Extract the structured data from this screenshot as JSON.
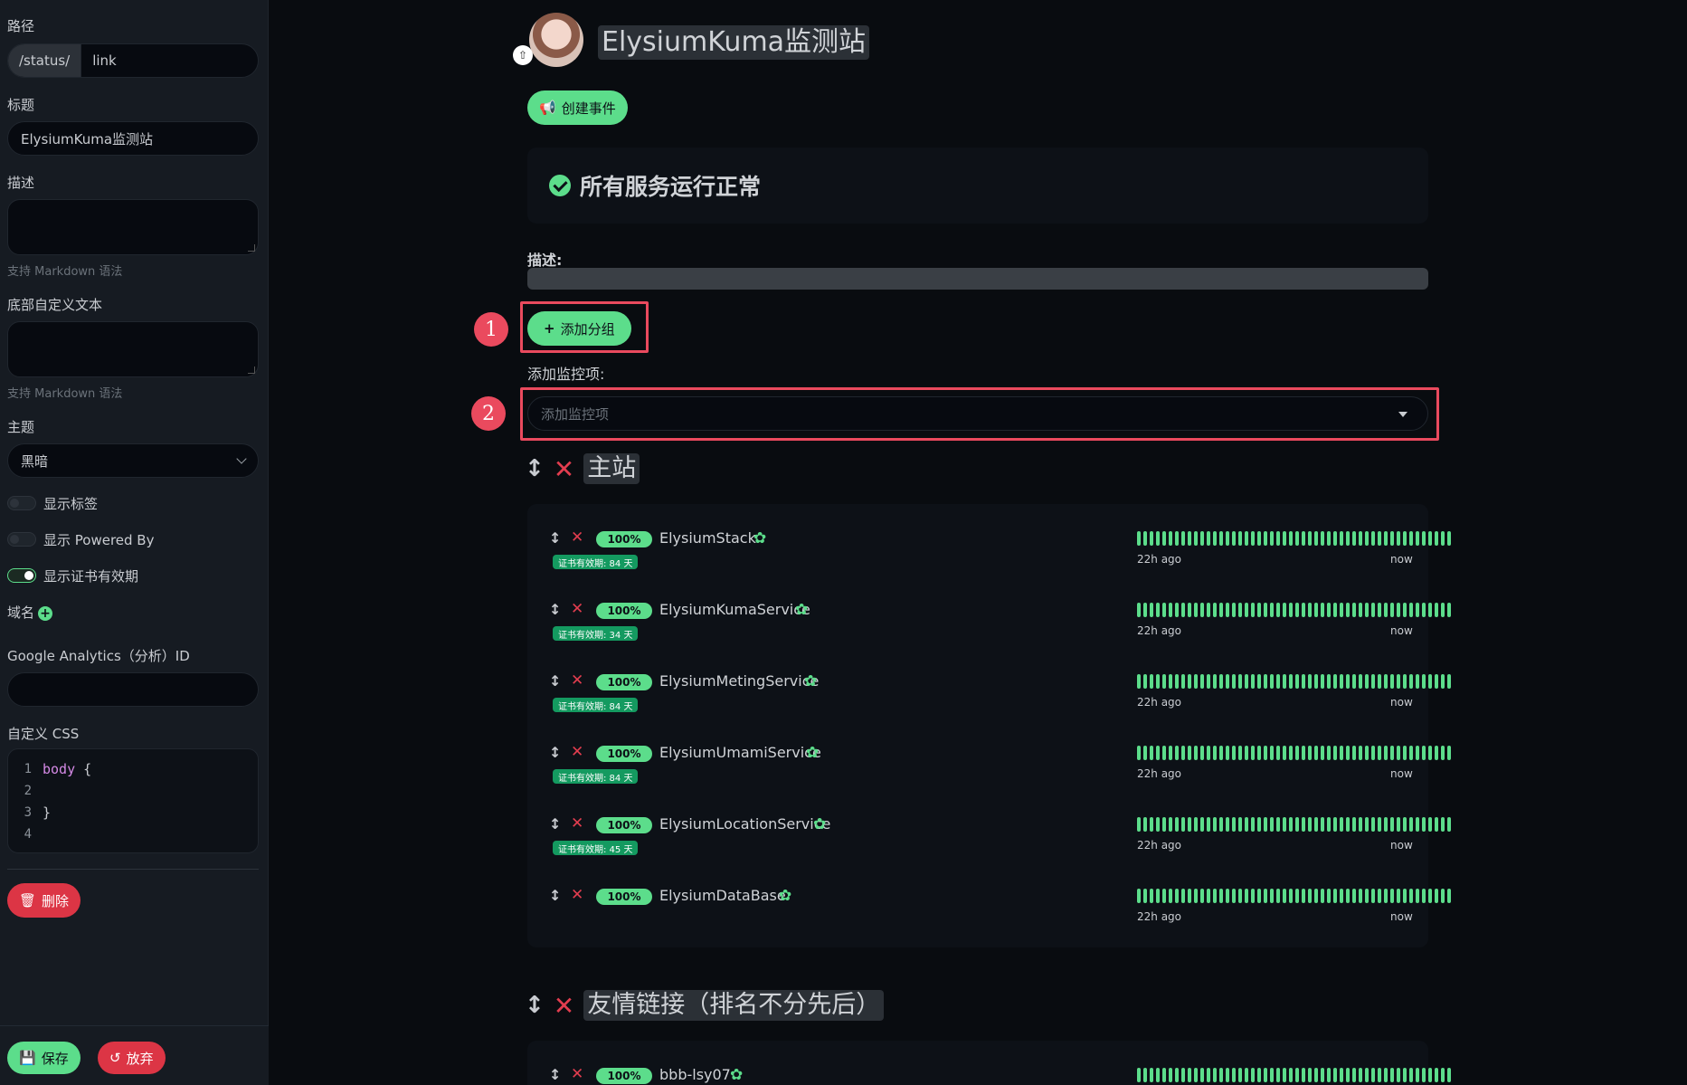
{
  "sidebar": {
    "path_label": "路径",
    "path_prefix": "/status/",
    "path_value": "link",
    "title_label": "标题",
    "title_value": "ElysiumKuma监测站",
    "desc_label": "描述",
    "desc_hint": "支持 Markdown 语法",
    "footer_label": "底部自定义文本",
    "footer_hint": "支持 Markdown 语法",
    "theme_label": "主题",
    "theme_value": "黑暗",
    "toggles": [
      {
        "label": "显示标签",
        "on": false
      },
      {
        "label": "显示 Powered By",
        "on": false
      },
      {
        "label": "显示证书有效期",
        "on": true
      }
    ],
    "domain_label": "域名",
    "ga_label": "Google Analytics（分析）ID",
    "css_label": "自定义 CSS",
    "css_lines": [
      {
        "n": "1",
        "code_kw": "body",
        "code_rest": " {"
      },
      {
        "n": "2",
        "code_kw": "",
        "code_rest": ""
      },
      {
        "n": "3",
        "code_kw": "",
        "code_rest": "}"
      },
      {
        "n": "4",
        "code_kw": "",
        "code_rest": ""
      }
    ],
    "delete_label": "删除",
    "save_label": "保存",
    "discard_label": "放弃"
  },
  "main": {
    "site_title": "ElysiumKuma监测站",
    "create_incident": "创建事件",
    "status_text": "所有服务运行正常",
    "desc_label": "描述:",
    "add_group": "添加分组",
    "add_monitor_label": "添加监控项:",
    "add_monitor_placeholder": "添加监控项",
    "annotations": [
      "1",
      "2"
    ],
    "groups": [
      {
        "title": "主站",
        "monitors": [
          {
            "uptime": "100%",
            "name": "ElysiumStack",
            "cert": "证书有效期: 84 天",
            "start": "22h ago",
            "end": "now"
          },
          {
            "uptime": "100%",
            "name": "ElysiumKumaService",
            "cert": "证书有效期: 34 天",
            "start": "22h ago",
            "end": "now"
          },
          {
            "uptime": "100%",
            "name": "ElysiumMetingService",
            "cert": "证书有效期: 84 天",
            "start": "22h ago",
            "end": "now"
          },
          {
            "uptime": "100%",
            "name": "ElysiumUmamiService",
            "cert": "证书有效期: 84 天",
            "start": "22h ago",
            "end": "now"
          },
          {
            "uptime": "100%",
            "name": "ElysiumLocationService",
            "cert": "证书有效期: 45 天",
            "start": "22h ago",
            "end": "now"
          },
          {
            "uptime": "100%",
            "name": "ElysiumDataBase",
            "cert": "",
            "start": "22h ago",
            "end": "now"
          }
        ]
      },
      {
        "title": "友情链接（排名不分先后）",
        "monitors": [
          {
            "uptime": "100%",
            "name": "bbb-lsy07",
            "cert": "",
            "start": "",
            "end": ""
          }
        ]
      }
    ]
  },
  "colors": {
    "accent": "#5cdd8b",
    "danger": "#dc3545",
    "highlight": "#ea4a5e",
    "bg": "#090c10",
    "card": "#0d1117"
  }
}
